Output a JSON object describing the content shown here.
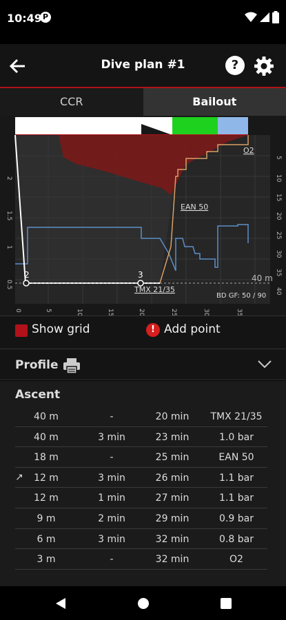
{
  "status": {
    "time": "10:49",
    "app_badge": "P"
  },
  "appbar": {
    "title": "Dive plan #1",
    "help_label": "?"
  },
  "tabs": [
    {
      "label": "CCR",
      "active": false
    },
    {
      "label": "Bailout",
      "active": true
    }
  ],
  "chart": {
    "point_labels": [
      "2",
      "3"
    ],
    "depth_marker": "40 m",
    "gas_labels": [
      "O2",
      "EAN 50",
      "TMX 21/35"
    ],
    "gf_label": "BD GF: 50 / 90",
    "left_axis_ticks": [
      "2",
      "1.5",
      "1",
      "0.5"
    ],
    "right_axis_ticks": [
      "5",
      "10",
      "15",
      "20",
      "25",
      "30",
      "35",
      "40"
    ],
    "bottom_axis_ticks": [
      "0",
      "5",
      "10",
      "15",
      "20",
      "25",
      "30",
      "35"
    ]
  },
  "controls": {
    "show_grid_label": "Show grid",
    "add_point_label": "Add point",
    "add_point_icon": "!",
    "show_grid_checked": true
  },
  "profile": {
    "title": "Profile"
  },
  "ascent": {
    "title": "Ascent",
    "rows": [
      {
        "depth": "40 m",
        "stop": "-",
        "runtime": "20 min",
        "gas": "TMX 21/35",
        "marker": ""
      },
      {
        "depth": "40 m",
        "stop": "3 min",
        "runtime": "23 min",
        "gas": "1.0 bar",
        "marker": ""
      },
      {
        "depth": "18 m",
        "stop": "-",
        "runtime": "25 min",
        "gas": "EAN 50",
        "marker": ""
      },
      {
        "depth": "12 m",
        "stop": "3 min",
        "runtime": "26 min",
        "gas": "1.1 bar",
        "marker": "↗"
      },
      {
        "depth": "12 m",
        "stop": "1 min",
        "runtime": "27 min",
        "gas": "1.1 bar",
        "marker": ""
      },
      {
        "depth": "9 m",
        "stop": "2 min",
        "runtime": "29 min",
        "gas": "0.9 bar",
        "marker": ""
      },
      {
        "depth": "6 m",
        "stop": "3 min",
        "runtime": "32 min",
        "gas": "0.8 bar",
        "marker": ""
      },
      {
        "depth": "3 m",
        "stop": "-",
        "runtime": "32 min",
        "gas": "O2",
        "marker": ""
      }
    ]
  },
  "colors": {
    "accent": "#b1121a",
    "profile_line": "#ffffff",
    "ppo2_line": "#5b8fc9",
    "ceiling_fill": "#7a1a1a",
    "ascent_line": "#d9a066"
  }
}
